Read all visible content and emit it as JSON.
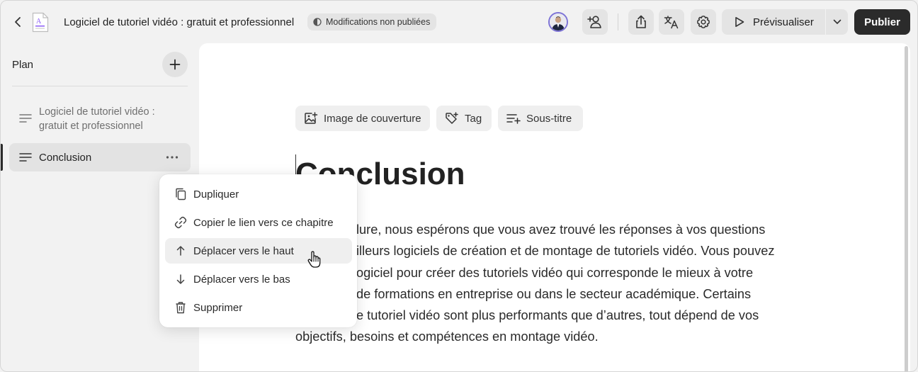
{
  "header": {
    "document_title": "Logiciel de tutoriel vidéo : gratuit et professionnel",
    "status": "Modifications non publiées",
    "preview_label": "Prévisualiser",
    "publish_label": "Publier",
    "doc_icon_letter": "A"
  },
  "sidebar": {
    "title": "Plan",
    "items": [
      {
        "line1": "Logiciel de tutoriel vidéo :",
        "line2": "gratuit et professionnel"
      },
      {
        "label": "Conclusion"
      }
    ]
  },
  "editor": {
    "chips": [
      {
        "label": "Image de couverture",
        "icon": "image-plus-icon"
      },
      {
        "label": "Tag",
        "icon": "tag-plus-icon"
      },
      {
        "label": "Sous-titre",
        "icon": "subtitle-plus-icon"
      }
    ],
    "heading": "Conclusion",
    "paragraph_lines": [
      "lure, nous espérons que vous avez trouvé les réponses à vos questions",
      "illeurs logiciels de création et de montage de tutoriels vidéo. Vous pouvez",
      "ogiciel pour créer des tutoriels vidéo qui corresponde le mieux à votre",
      "de formations en entreprise ou dans le secteur académique. Certains",
      "e tutoriel vidéo sont plus performants que d’autres, tout dépend de vos",
      "objectifs, besoins et compétences en montage vidéo."
    ]
  },
  "context_menu": {
    "items": [
      {
        "label": "Dupliquer",
        "icon": "copy-icon"
      },
      {
        "label": "Copier le lien vers ce chapitre",
        "icon": "link-icon"
      },
      {
        "label": "Déplacer vers le haut",
        "icon": "arrow-up-icon"
      },
      {
        "label": "Déplacer vers le bas",
        "icon": "arrow-down-icon"
      },
      {
        "label": "Supprimer",
        "icon": "trash-icon"
      }
    ],
    "hovered_index": 2
  },
  "colors": {
    "accent_dark": "#2b2b2b",
    "avatar_ring": "#7d73d6",
    "doc_icon_accent": "#8b5cf6"
  }
}
